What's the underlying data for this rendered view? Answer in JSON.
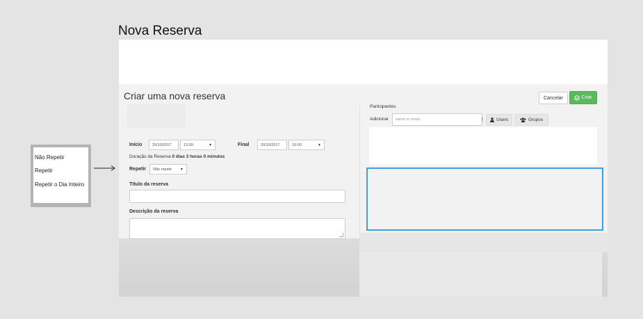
{
  "page": {
    "title": "Nova Reserva"
  },
  "form": {
    "heading": "Criar uma nova reserva",
    "buttons": {
      "cancel": "Cancelar",
      "create": "Criar"
    },
    "start": {
      "label": "Início",
      "date": "20/10/2017",
      "time": "13:00"
    },
    "end": {
      "label": "Final",
      "date": "20/10/2017",
      "time": "16:00"
    },
    "duration": {
      "label": "Duração da Reserva",
      "value": "0 dias 3 horas 0 minutos"
    },
    "repeat": {
      "label": "Repetir",
      "value": "Não repetir"
    },
    "title_field": {
      "label": "Título da reserva",
      "value": ""
    },
    "description_field": {
      "label": "Descrição da reserva",
      "value": ""
    }
  },
  "participants": {
    "label": "Participantes",
    "add_label": "Adicionar",
    "input_placeholder": "name or email",
    "separator": "|",
    "users_button": "Users",
    "groups_button": "Grupos"
  },
  "repeat_options": [
    "Não Repetir",
    "Repetir",
    "Repetir o Dia Inteiro"
  ],
  "colors": {
    "highlight": "#3aa0e3",
    "create_button": "#5cb85c"
  }
}
